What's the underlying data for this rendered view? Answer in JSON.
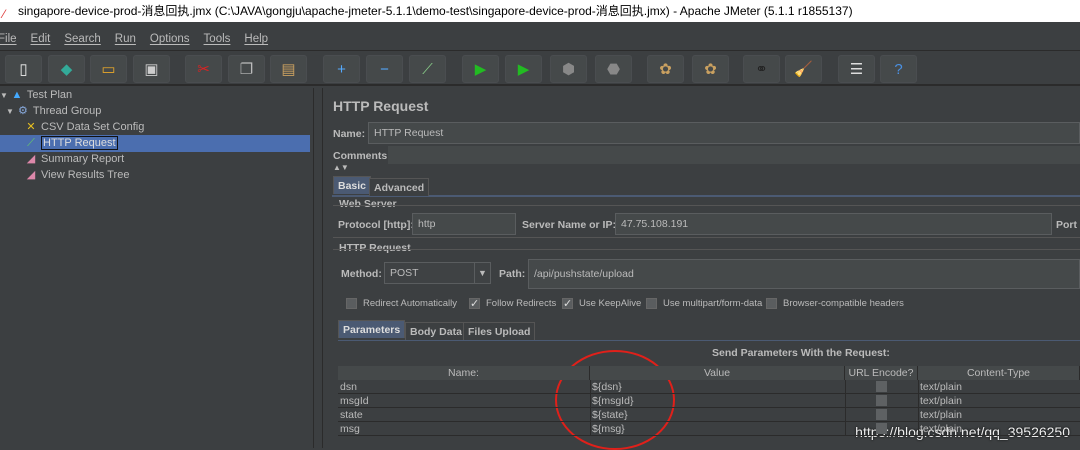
{
  "window": {
    "title": "singapore-device-prod-消息回执.jmx (C:\\JAVA\\gongju\\apache-jmeter-5.1.1\\demo-test\\singapore-device-prod-消息回执.jmx) - Apache JMeter (5.1.1 r1855137)"
  },
  "menu": [
    "File",
    "Edit",
    "Search",
    "Run",
    "Options",
    "Tools",
    "Help"
  ],
  "toolbar": [
    {
      "name": "new-icon",
      "glyph": "▯"
    },
    {
      "name": "templates-icon",
      "glyph": "◆"
    },
    {
      "name": "open-icon",
      "glyph": "▭"
    },
    {
      "name": "save-icon",
      "glyph": "▣"
    },
    {
      "name": "cut-icon",
      "glyph": "✂"
    },
    {
      "name": "copy-icon",
      "glyph": "❐"
    },
    {
      "name": "paste-icon",
      "glyph": "▤"
    },
    {
      "name": "expand-icon",
      "glyph": "+"
    },
    {
      "name": "collapse-icon",
      "glyph": "−"
    },
    {
      "name": "toggle-icon",
      "glyph": "⟋"
    },
    {
      "name": "start-icon",
      "glyph": "▶"
    },
    {
      "name": "start-no-pause-icon",
      "glyph": "▶"
    },
    {
      "name": "stop-icon",
      "glyph": "⬢"
    },
    {
      "name": "shutdown-icon",
      "glyph": "⬣"
    },
    {
      "name": "clear-icon",
      "glyph": "✿"
    },
    {
      "name": "clear-all-icon",
      "glyph": "✿"
    },
    {
      "name": "search-icon",
      "glyph": "⚭"
    },
    {
      "name": "reset-search-icon",
      "glyph": "🧹"
    },
    {
      "name": "function-helper-icon",
      "glyph": "☰"
    },
    {
      "name": "help-icon",
      "glyph": "?"
    }
  ],
  "tree": [
    {
      "label": "Test Plan",
      "icon": "flask-icon",
      "glyph": "▲",
      "level": 0
    },
    {
      "label": "Thread Group",
      "icon": "gear-icon",
      "glyph": "⚙",
      "level": 1
    },
    {
      "label": "CSV Data Set Config",
      "icon": "tools-icon",
      "glyph": "✕",
      "level": 2
    },
    {
      "label": "HTTP Request",
      "icon": "pipette-icon",
      "glyph": "⟋",
      "level": 2
    },
    {
      "label": "Summary Report",
      "icon": "chart-icon",
      "glyph": "◢",
      "level": 2
    },
    {
      "label": "View Results Tree",
      "icon": "chart-icon",
      "glyph": "◢",
      "level": 2
    }
  ],
  "panel": {
    "title": "HTTP Request",
    "name_label": "Name:",
    "name_value": "HTTP Request",
    "comments_label": "Comments:",
    "tabs": [
      "Basic",
      "Advanced"
    ],
    "web_server": {
      "legend": "Web Server",
      "protocol_label": "Protocol [http]:",
      "protocol": "http",
      "server_label": "Server Name or IP:",
      "server": "47.75.108.191",
      "port_label": "Port"
    },
    "http_request": {
      "legend": "HTTP Request",
      "method_label": "Method:",
      "method": "POST",
      "path_label": "Path:",
      "path": "/api/pushstate/upload"
    },
    "options": [
      {
        "label": "Redirect Automatically",
        "checked": false
      },
      {
        "label": "Follow Redirects",
        "checked": true
      },
      {
        "label": "Use KeepAlive",
        "checked": true
      },
      {
        "label": "Use multipart/form-data",
        "checked": false
      },
      {
        "label": "Browser-compatible headers",
        "checked": false
      }
    ],
    "sub_tabs": [
      "Parameters",
      "Body Data",
      "Files Upload"
    ],
    "params_title": "Send Parameters With the Request:",
    "columns": [
      "Name:",
      "Value",
      "URL Encode?",
      "Content-Type"
    ],
    "rows": [
      {
        "name": "dsn",
        "value": "${dsn}",
        "encode": false,
        "type": "text/plain"
      },
      {
        "name": "msgId",
        "value": "${msgId}",
        "encode": false,
        "type": "text/plain"
      },
      {
        "name": "state",
        "value": "${state}",
        "encode": false,
        "type": "text/plain"
      },
      {
        "name": "msg",
        "value": "${msg}",
        "encode": false,
        "type": "text/plain"
      }
    ]
  },
  "watermark": "https://blog.csdn.net/qq_39526250",
  "colors": {
    "bg": "#3c3f41",
    "selection": "#4b6eaf",
    "annotation": "#e0201a"
  }
}
